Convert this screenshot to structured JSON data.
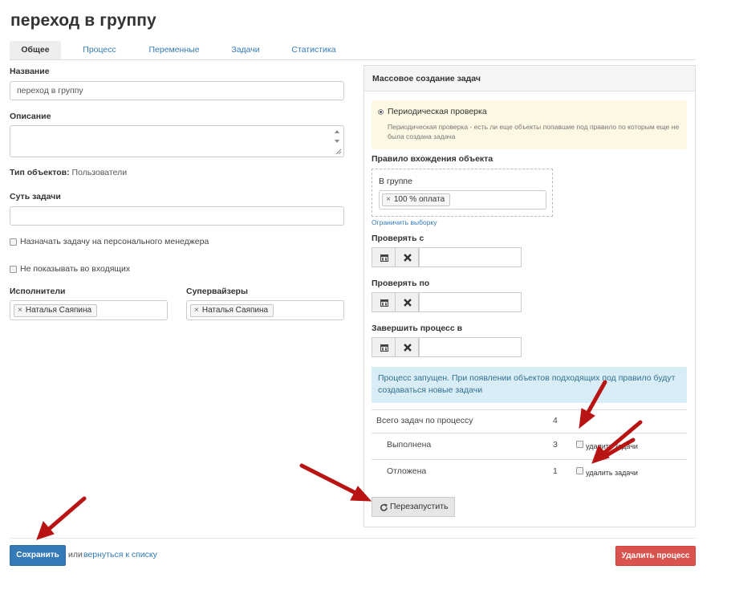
{
  "page": {
    "title": "переход в группу"
  },
  "tabs": [
    {
      "label": "Общее",
      "active": true
    },
    {
      "label": "Процесс",
      "active": false
    },
    {
      "label": "Переменные",
      "active": false
    },
    {
      "label": "Задачи",
      "active": false
    },
    {
      "label": "Статистика",
      "active": false
    }
  ],
  "form": {
    "name_label": "Название",
    "name_value": "переход в группу",
    "description_label": "Описание",
    "description_value": "",
    "object_type_label": "Тип объектов",
    "object_type_value": "Пользователи",
    "task_essence_label": "Суть задачи",
    "task_essence_value": "",
    "assign_personal_manager": {
      "label": "Назначать задачу на персонального менеджера",
      "checked": false
    },
    "hide_from_inbox": {
      "label": "Не показывать во входящих",
      "checked": false
    },
    "executors_label": "Исполнители",
    "executors": [
      "Наталья Саяпина"
    ],
    "supervisors_label": "Супервайзеры",
    "supervisors": [
      "Наталья Саяпина"
    ]
  },
  "panel": {
    "title": "Массовое создание задач",
    "mode": {
      "label": "Периодическая проверка",
      "selected": true,
      "description": "Периодическая проверка - есть ли еще объекты попавшие под правило по которым еще не была создана задача"
    },
    "rule_label": "Правило вхождения объекта",
    "rule_group_label": "В группе",
    "rule_group_tags": [
      "100 % оплата"
    ],
    "limit_link": "Ограничить выборку",
    "check_from_label": "Проверять с",
    "check_from_value": "",
    "check_to_label": "Проверять по",
    "check_to_value": "",
    "finish_label": "Завершить процесс в",
    "finish_value": "",
    "status_message": "Процесс запущен. При появлении объектов подходящих под правило будут создаваться новые задачи",
    "stats": [
      {
        "label": "Всего задач по процессу",
        "value": "4",
        "delete_label": "",
        "indent": false
      },
      {
        "label": "Выполнена",
        "value": "3",
        "delete_label": "удалить задачи",
        "indent": true
      },
      {
        "label": "Отложена",
        "value": "1",
        "delete_label": "удалить задачи",
        "indent": true
      }
    ],
    "restart_label": "Перезапустить"
  },
  "footer": {
    "save_label": "Сохранить",
    "or_text": "или",
    "back_link": "вернуться к списку",
    "delete_label": "Удалить процесс"
  },
  "colors": {
    "primary": "#337ab7",
    "danger": "#d9534f",
    "warning_bg": "#fcf8e3",
    "info_bg": "#d9edf7",
    "arrow": "#b81414"
  }
}
